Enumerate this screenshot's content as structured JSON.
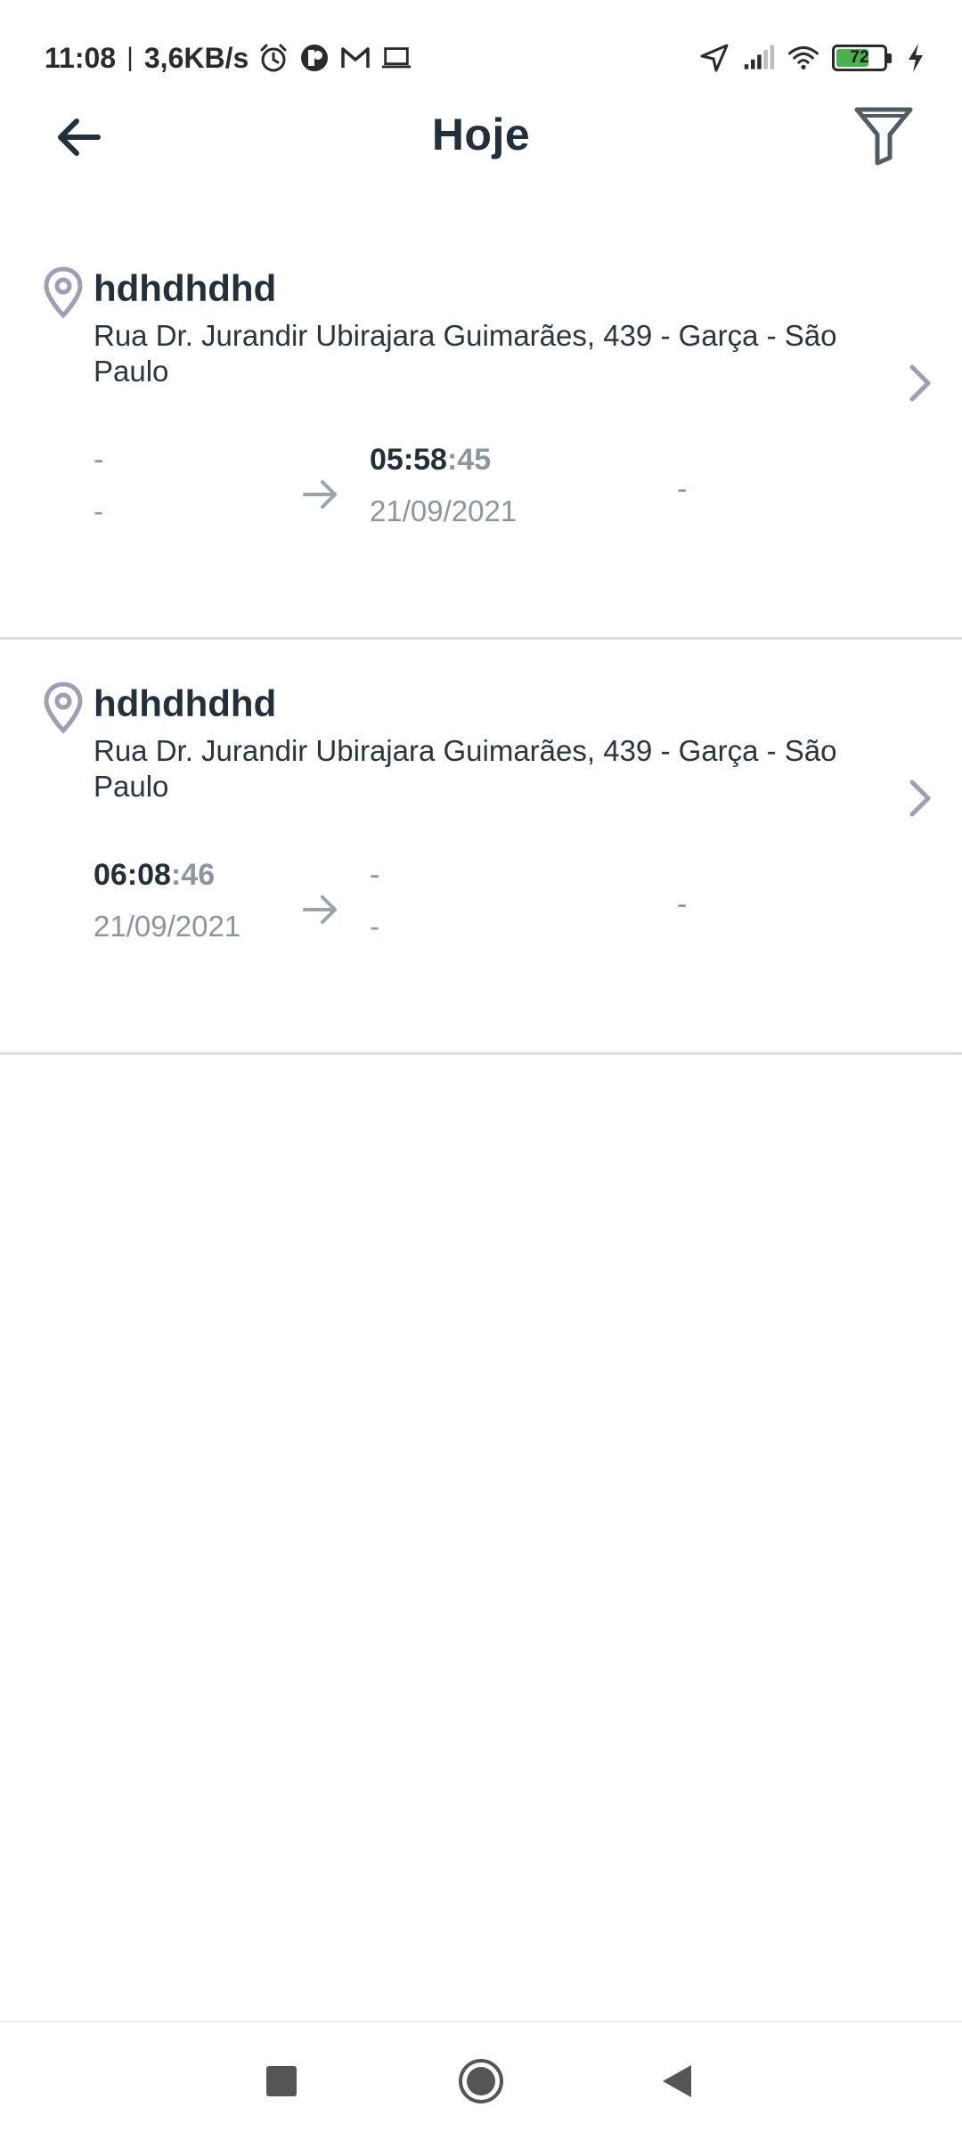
{
  "status_bar": {
    "time": "11:08",
    "separator": "|",
    "net_speed": "3,6KB/s",
    "left_icons": [
      "alarm-icon",
      "app-notification-icon",
      "gmail-icon",
      "laptop-icon"
    ],
    "right_icons": [
      "location-arrow-icon",
      "signal-icon",
      "wifi-icon",
      "battery-icon",
      "charging-bolt-icon"
    ],
    "battery_level": "72",
    "battery_percent": 72,
    "battery_color": "#4caf50"
  },
  "app_bar": {
    "title": "Hoje",
    "back_icon": "arrow-left-icon",
    "filter_icon": "filter-icon"
  },
  "records": [
    {
      "title": "hdhdhdhd",
      "address": "Rua Dr. Jurandir Ubirajara Guimarães, 439 - Garça - São Paulo",
      "start": {
        "hm": "",
        "sec": "",
        "date": "",
        "dash_time": "-",
        "dash_date": "-"
      },
      "end": {
        "hm": "05:58",
        "sec": ":45",
        "date": "21/09/2021"
      },
      "duration": "-"
    },
    {
      "title": "hdhdhdhd",
      "address": "Rua Dr. Jurandir Ubirajara Guimarães, 439 - Garça - São Paulo",
      "start": {
        "hm": "06:08",
        "sec": ":46",
        "date": "21/09/2021"
      },
      "end": {
        "hm": "",
        "sec": "",
        "date": "",
        "dash_time": "-",
        "dash_date": "-"
      },
      "duration": "-"
    }
  ],
  "colors": {
    "text_primary": "#232f39",
    "text_secondary": "#8b96a0",
    "pin_color": "#a39cb5",
    "divider": "#dcdfe2"
  },
  "nav_bar": {
    "buttons": [
      "recents-square-icon",
      "home-circle-icon",
      "back-triangle-icon"
    ]
  }
}
